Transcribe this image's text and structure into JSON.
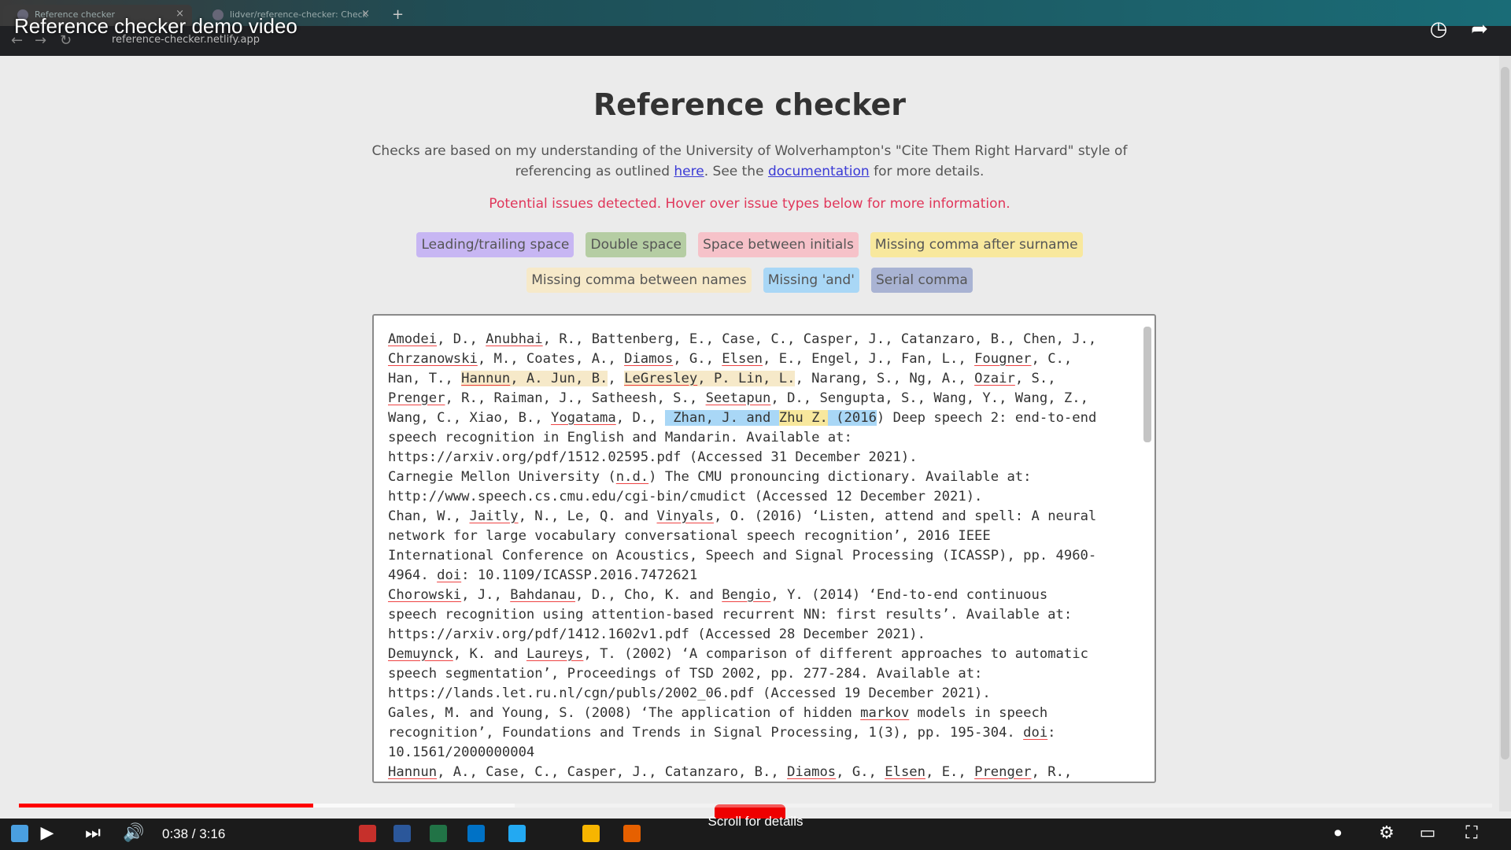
{
  "browser": {
    "tabs": [
      {
        "label": "Reference checker"
      },
      {
        "label": "lidver/reference-checker: Check"
      }
    ],
    "url": "reference-checker.netlify.app"
  },
  "video": {
    "title": "Reference checker demo video",
    "time": "0:38 / 3:16",
    "scroll_hint": "Scroll for details",
    "progress": 0.2
  },
  "page": {
    "title": "Reference checker",
    "intro_before_here": "Checks are based on my understanding of the University of Wolverhampton's \"Cite Them Right Harvard\" style of referencing as outlined ",
    "intro_here": "here",
    "intro_middle": ". See the ",
    "intro_doc": "documentation",
    "intro_after": " for more details.",
    "warning": "Potential issues detected. Hover over issue types below for more information.",
    "tags_row1": [
      {
        "label": "Leading/trailing space",
        "color": "#c7b6f3"
      },
      {
        "label": "Double space",
        "color": "#b5cda3"
      },
      {
        "label": "Space between initials",
        "color": "#f6c2c9"
      },
      {
        "label": "Missing comma after surname",
        "color": "#f8e89d"
      }
    ],
    "tags_row2": [
      {
        "label": "Missing comma between names",
        "color": "#f6e9c9"
      },
      {
        "label": "Missing 'and'",
        "color": "#a9d7f6"
      },
      {
        "label": "Serial comma",
        "color": "#a9b3d3"
      }
    ]
  }
}
